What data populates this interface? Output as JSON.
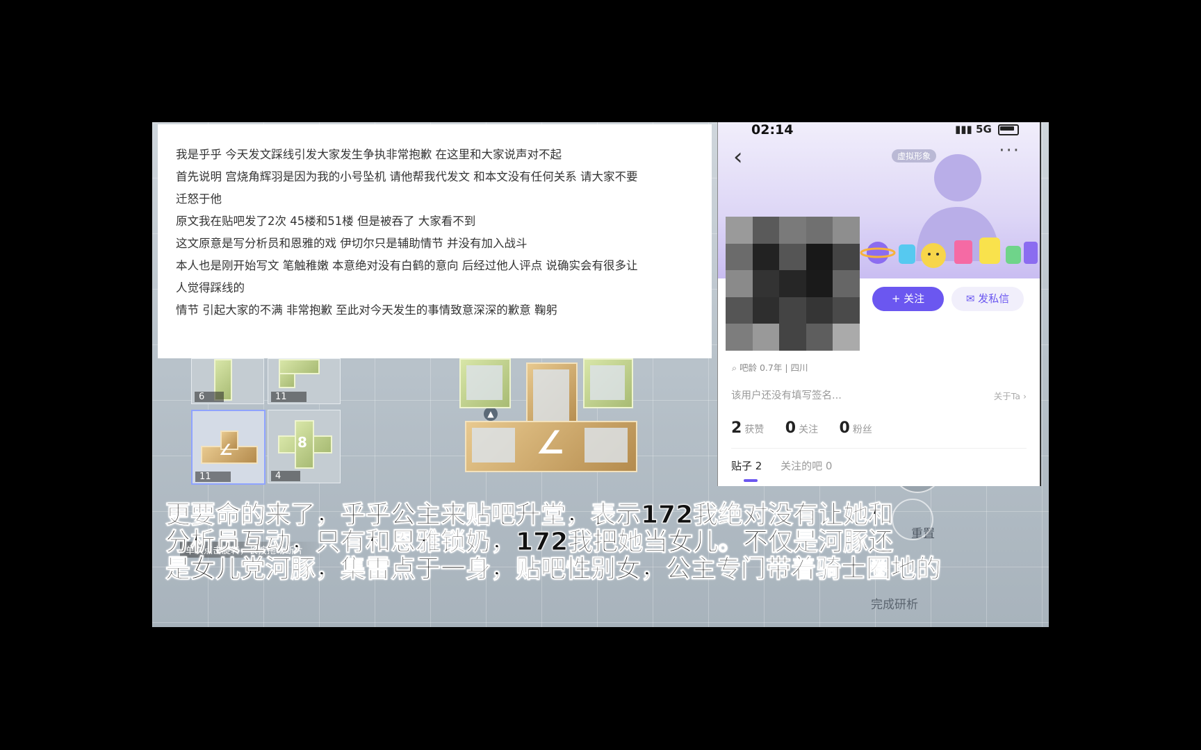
{
  "note_panel": {
    "lines": [
      "我是乎乎 今天发文踩线引发大家发生争执非常抱歉 在这里和大家说声对不起",
      "首先说明 宫烧角辉羽是因为我的小号坠机 请他帮我代发文 和本文没有任何关系 请大家不要",
      "迁怒于他",
      "原文我在贴吧发了2次 45楼和51楼 但是被吞了 大家看不到",
      "这文原意是写分析员和恩雅的戏 伊切尔只是辅助情节 并没有加入战斗",
      "本人也是刚开始写文 笔触稚嫩 本意绝对没有白鹤的意向 后经过他人评点 说确实会有很多让",
      "人觉得踩线的",
      "情节 引起大家的不满 非常抱歉 至此对今天发生的事情致意深深的歉意 鞠躬"
    ]
  },
  "phone": {
    "status_time": "02:14",
    "status_network": "5G",
    "virtual_badge": "虚拟形象",
    "follow_label": "+ 关注",
    "message_label": "发私信",
    "meta": "吧龄 0.7年 | 四川",
    "signature": "该用户还没有填写签名...",
    "about": "关于Ta",
    "stats": [
      {
        "num": "2",
        "label": "获赞"
      },
      {
        "num": "0",
        "label": "关注"
      },
      {
        "num": "0",
        "label": "粉丝"
      }
    ],
    "tabs": [
      {
        "label": "贴子 2"
      },
      {
        "label": "关注的吧 0"
      }
    ]
  },
  "game": {
    "slot_numbers": [
      "6",
      "11",
      "11",
      "4"
    ],
    "piece_symbols": [
      "∠",
      "8",
      "∠"
    ],
    "hint": "单次点击旋转，长按拖动断片",
    "reset_label": "重置",
    "finish_label": "完成研析"
  },
  "subtitles": [
    "更要命的来了，乎乎公主来贴吧升堂，表示172我绝对没有让她和",
    "分析员互动，只有和恩雅锁奶，172我把她当女儿。不仅是河豚还",
    "是女儿党河豚，集雷点于一身，贴吧性别女，公主专门带着骑士圈地的"
  ],
  "colors": {
    "accent": "#6b57f0",
    "gold_piece": "#c9a063",
    "green_piece": "#bccd8a"
  }
}
